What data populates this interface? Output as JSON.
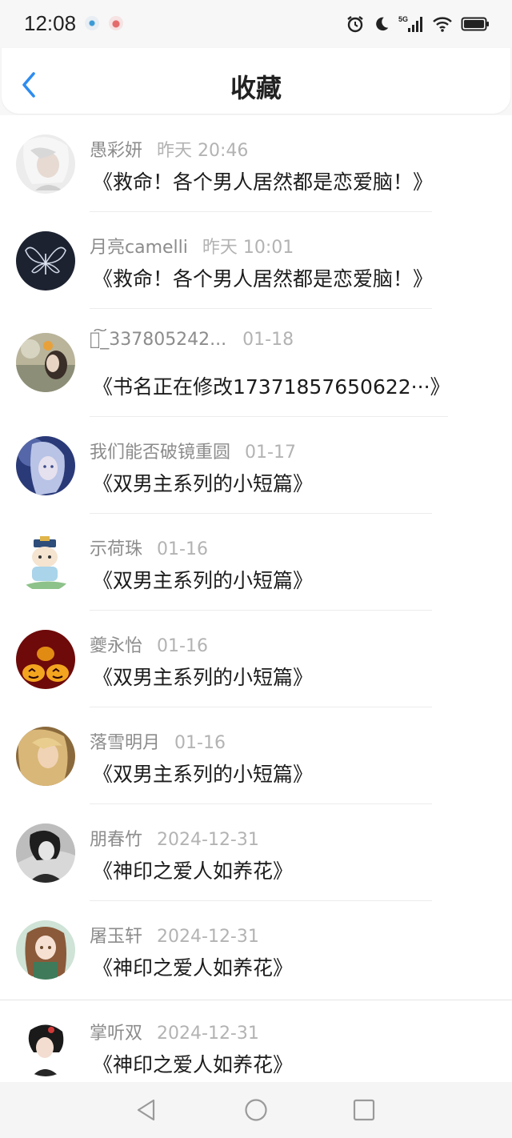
{
  "status_bar": {
    "time": "12:08",
    "network": "5G"
  },
  "header": {
    "title": "收藏"
  },
  "items": [
    {
      "user": "愚彩妍",
      "time": "昨天 20:46",
      "book": "《救命！各个男人居然都是恋爱脑！》"
    },
    {
      "user": "月亮camelli",
      "time": "昨天 10:01",
      "book": "《救命！各个男人居然都是恋爱脑！》"
    },
    {
      "user": "ᯤ͠_337805242...",
      "time": "01-18",
      "book": "《书名正在修改17371857650622···》"
    },
    {
      "user": "我们能否破镜重圆",
      "time": "01-17",
      "book": "《双男主系列的小短篇》"
    },
    {
      "user": "示荷珠",
      "time": "01-16",
      "book": "《双男主系列的小短篇》"
    },
    {
      "user": "夔永怡",
      "time": "01-16",
      "book": "《双男主系列的小短篇》"
    },
    {
      "user": "落雪明月",
      "time": "01-16",
      "book": "《双男主系列的小短篇》"
    },
    {
      "user": "朋春竹",
      "time": "2024-12-31",
      "book": "《神印之爱人如养花》"
    },
    {
      "user": "屠玉轩",
      "time": "2024-12-31",
      "book": "《神印之爱人如养花》"
    },
    {
      "user": "掌听双",
      "time": "2024-12-31",
      "book": "《神印之爱人如养花》"
    }
  ],
  "colors": {
    "accent": "#2d8cf0",
    "meta_text": "#8c8c8c",
    "time_text": "#b3b3b3"
  },
  "icons": {
    "back": "chevron-left-icon",
    "alarm": "alarm-icon",
    "moon": "moon-icon",
    "signal": "signal-icon",
    "wifi": "wifi-icon",
    "battery": "battery-icon"
  }
}
